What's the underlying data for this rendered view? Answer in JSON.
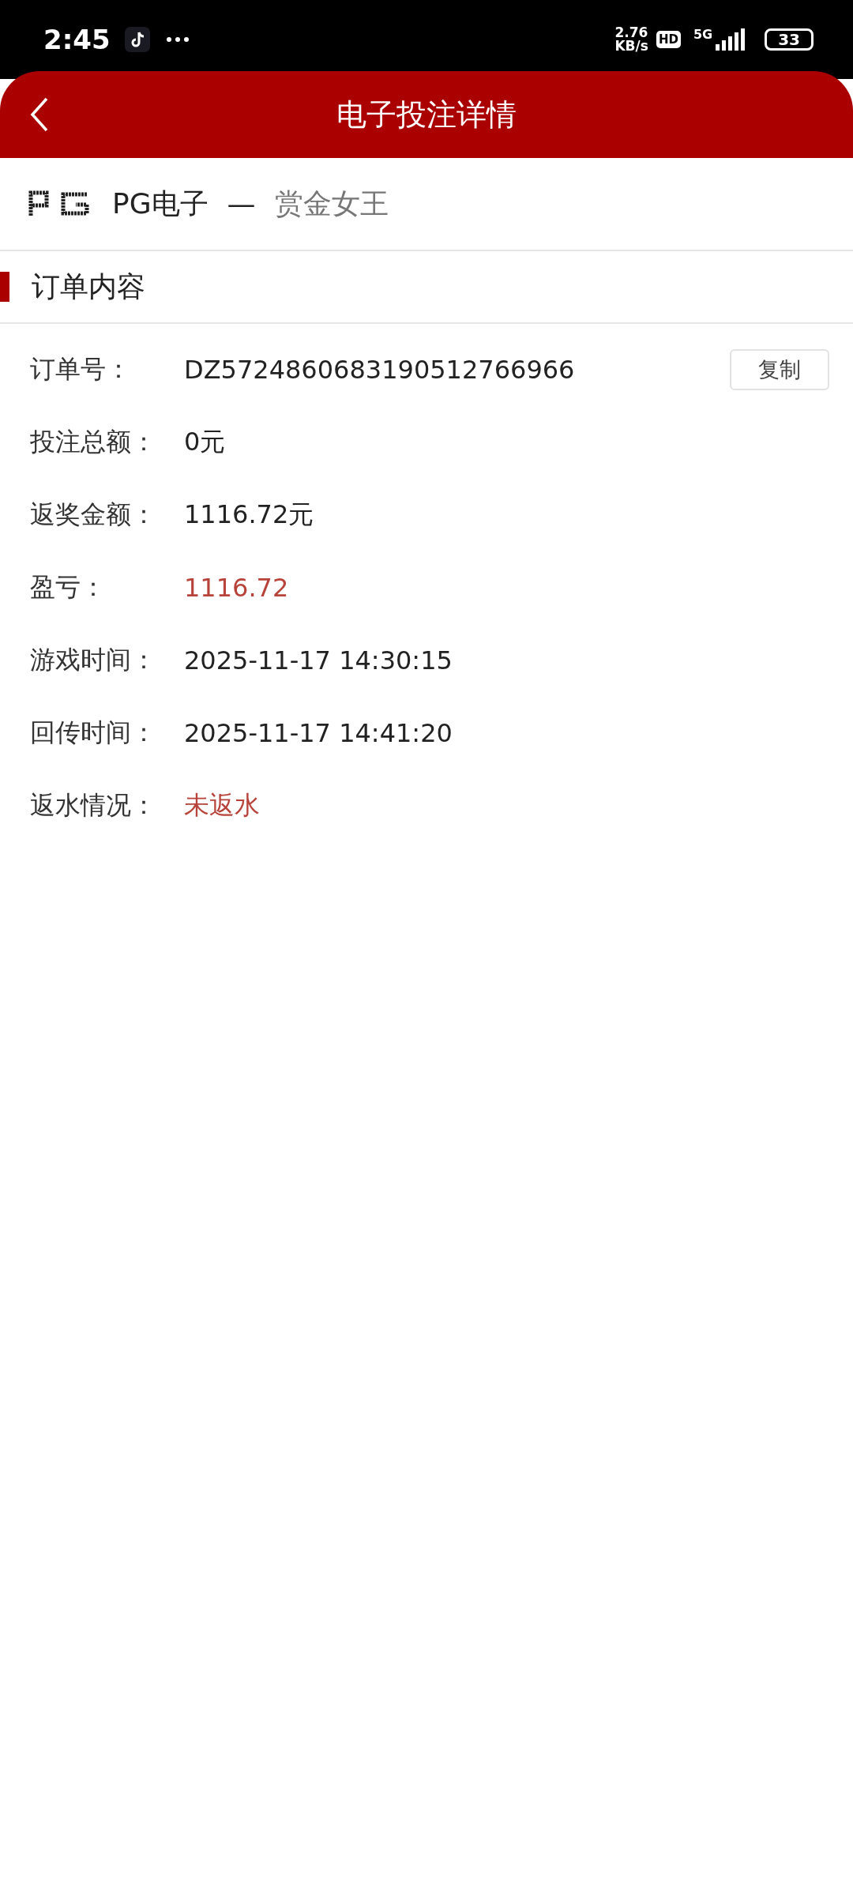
{
  "status_bar": {
    "time": "2:45",
    "speed_value": "2.76",
    "speed_unit": "KB/s",
    "hd": "HD",
    "network": "5G",
    "battery": "33"
  },
  "header": {
    "title": "电子投注详情"
  },
  "game": {
    "provider": "PG电子",
    "separator": "—",
    "name": "赏金女王"
  },
  "section": {
    "title": "订单内容"
  },
  "rows": [
    {
      "kind": "copyable",
      "label": "订单号：",
      "value": "DZ5724860683190512766966",
      "button": "复制"
    },
    {
      "kind": "plain",
      "label": "投注总额：",
      "value": "0元"
    },
    {
      "kind": "plain",
      "label": "返奖金额：",
      "value": "1116.72元"
    },
    {
      "kind": "alert",
      "label": "盈亏：",
      "value": "1116.72"
    },
    {
      "kind": "plain",
      "label": "游戏时间：",
      "value": "2025-11-17 14:30:15"
    },
    {
      "kind": "plain",
      "label": "回传时间：",
      "value": "2025-11-17 14:41:20"
    },
    {
      "kind": "alert",
      "label": "返水情况：",
      "value": "未返水"
    }
  ]
}
